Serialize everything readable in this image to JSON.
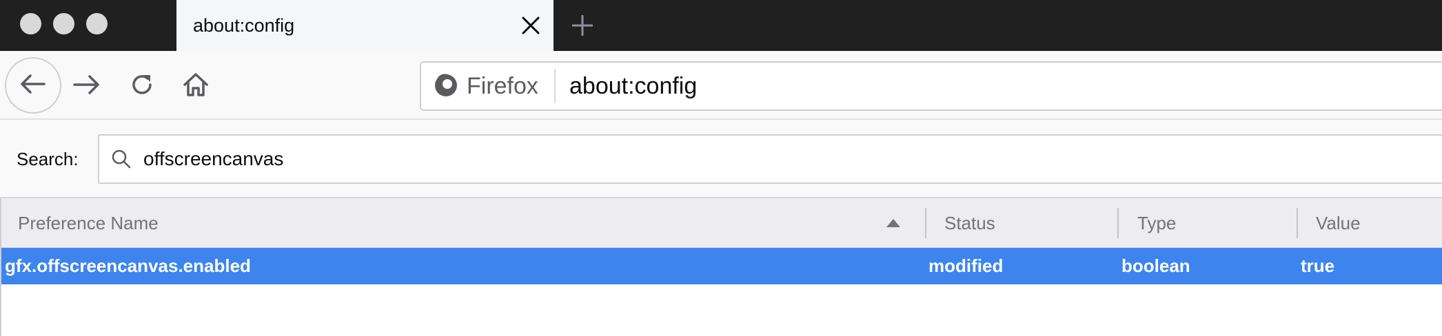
{
  "window": {
    "traffic_lights": [
      "close",
      "minimize",
      "zoom"
    ]
  },
  "tab": {
    "title": "about:config",
    "close_icon": "close-icon"
  },
  "newtab_icon": "plus-icon",
  "nav": {
    "back_icon": "arrow-left-icon",
    "forward_icon": "arrow-right-icon",
    "reload_icon": "reload-icon",
    "home_icon": "home-icon"
  },
  "urlbar": {
    "identity_icon": "firefox-logo-icon",
    "identity_label": "Firefox",
    "url": "about:config"
  },
  "search": {
    "label": "Search:",
    "value": "offscreencanvas",
    "icon": "search-icon"
  },
  "table": {
    "columns": [
      "Preference Name",
      "Status",
      "Type",
      "Value"
    ],
    "sorted_column": "Preference Name",
    "sort_direction": "ascending",
    "rows": [
      {
        "name": "gfx.offscreencanvas.enabled",
        "status": "modified",
        "type": "boolean",
        "value": "true",
        "selected": true
      }
    ]
  },
  "colors": {
    "tabstrip": "#202020",
    "selected_row": "#3d84ef",
    "header_bg": "#ededf0"
  }
}
